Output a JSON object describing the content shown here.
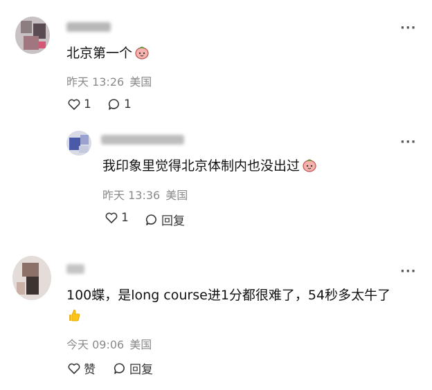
{
  "comments": [
    {
      "text": "北京第一个",
      "time": "昨天 13:26",
      "location": "美国",
      "like_label": "1",
      "reply_label": "1",
      "emoji": "peach-face-icon"
    },
    {
      "text": "我印象里觉得北京体制内也没出过",
      "time": "昨天 13:36",
      "location": "美国",
      "like_label": "1",
      "reply_label": "回复",
      "emoji": "peach-face-icon"
    },
    {
      "text_line1": "100蝶，是long course进1分都很难了，54秒多太牛了",
      "time": "今天 09:06",
      "location": "美国",
      "like_label": "赞",
      "reply_label": "回复",
      "emoji": "thumbs-up-icon"
    }
  ],
  "more_label": "···",
  "colors": {
    "meta": "#8a8a8a",
    "text": "#111111",
    "icon": "#333333"
  }
}
